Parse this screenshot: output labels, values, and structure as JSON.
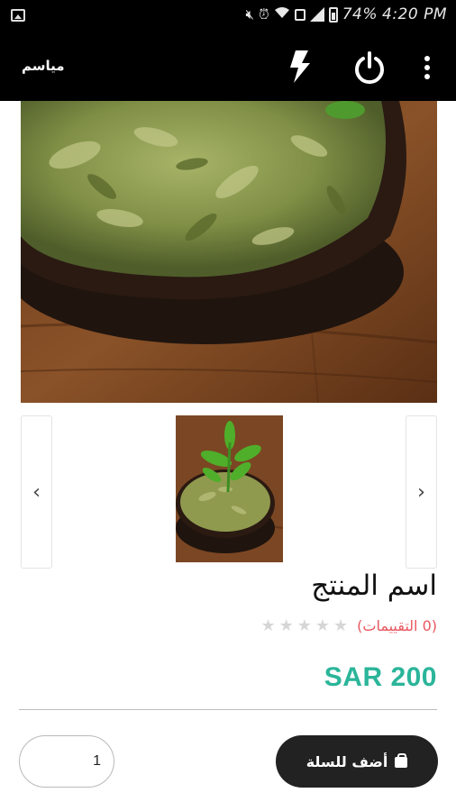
{
  "status_bar": {
    "battery_percent": "74%",
    "time": "4:20 PM"
  },
  "toolbar": {
    "title": "مياسم"
  },
  "product": {
    "name": "اسم المنتج",
    "rating_count": "(0 التقييمات)",
    "rating_value": 0,
    "rating_max": 5,
    "price": "SAR 200"
  },
  "quantity": {
    "value": "1"
  },
  "actions": {
    "add_to_cart": "أضف للسلة"
  },
  "colors": {
    "price": "#2bb59a",
    "rating_text": "#e8565f",
    "cart_button": "#222222"
  }
}
